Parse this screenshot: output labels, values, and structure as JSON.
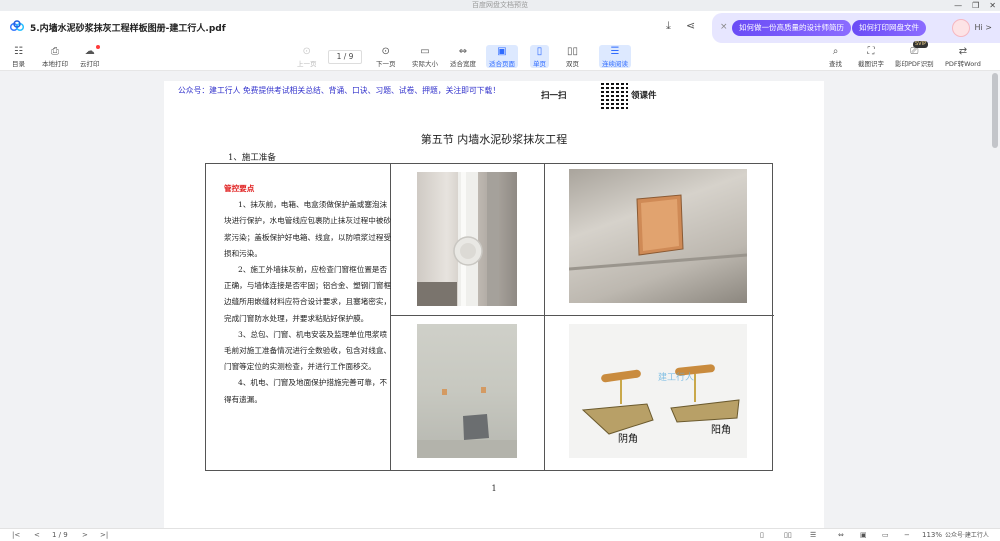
{
  "window": {
    "title": "百度网盘文档预览",
    "controls": [
      "—",
      "❐",
      "✕"
    ]
  },
  "document": {
    "filename": "5.内墙水泥砂浆抹灰工程样板图册-建工行人.pdf"
  },
  "promo": {
    "close": "×",
    "ask_label": "如何做一份高质量的设计师简历",
    "print_label": "如何打印网盘文件",
    "greeting": "Hi >"
  },
  "toolbar": {
    "catalog": "目录",
    "local_print": "本地打印",
    "cloud_print": "云打印",
    "prev_page": "上一页",
    "page_indicator": "1 / 9",
    "next_page": "下一页",
    "actual_size": "实际大小",
    "fit_width": "适合宽度",
    "fit_page": "适合页面",
    "single_page": "单页",
    "double_page": "双页",
    "continuous": "连续阅读",
    "search": "查找",
    "screenshot_ocr": "截图识字",
    "scan_pdf": "影印PDF识别",
    "pdf_to_word": "PDF转Word",
    "svip_badge": "SVIP"
  },
  "page": {
    "watermark_text": "公众号：建工行人  免费提供考试相关总结、背诵、口诀、习题、试卷、押题，关注即可下载！",
    "qr_label_left": "扫一扫",
    "qr_label_right": "领课件",
    "section_title": "第五节  内墙水泥砂浆抹灰工程",
    "prep_heading": "1、施工准备",
    "control_heading": "管控要点",
    "paragraphs": [
      "1、抹灰前，电箱、电盒须做保护盖或塞泡沫块进行保护，水电管线应包裹防止抹灰过程中被砂浆污染；盖板保护好电箱、线盒，以防喷浆过程受损和污染。",
      "2、施工外墙抹灰前，应检查门窗框位置是否正确，与墙体连接是否牢固；铝合金、塑钢门窗框边缝所用嵌缝材料应符合设计要求，且塞堵密实，完成门窗防水处理，并要求粘贴好保护膜。",
      "3、总包、门窗、机电安装及监理单位甩浆喷毛前对施工准备情况进行全数验收，包含对线盒、门窗等定位的实测检查，并进行工作面移交。",
      "4、机电、门窗及地面保护措施完善可靠，不得有遗漏。"
    ],
    "photo_labels": {
      "yin": "阴角",
      "yang": "阳角",
      "photo_watermark": "建工行人"
    },
    "page_number": "1"
  },
  "statusbar": {
    "first": "|<",
    "prev": "<",
    "page": "1 / 9",
    "next": ">",
    "last": ">|",
    "zoom_out": "−",
    "zoom": "113%",
    "zoom_in": "+",
    "wm_tail": "公众号·建工行人"
  },
  "colors": {
    "accent": "#2f6bff",
    "promo_pill": "#6a4cf6",
    "heading_red": "#e02020",
    "watermark_blue": "#3333cc"
  }
}
